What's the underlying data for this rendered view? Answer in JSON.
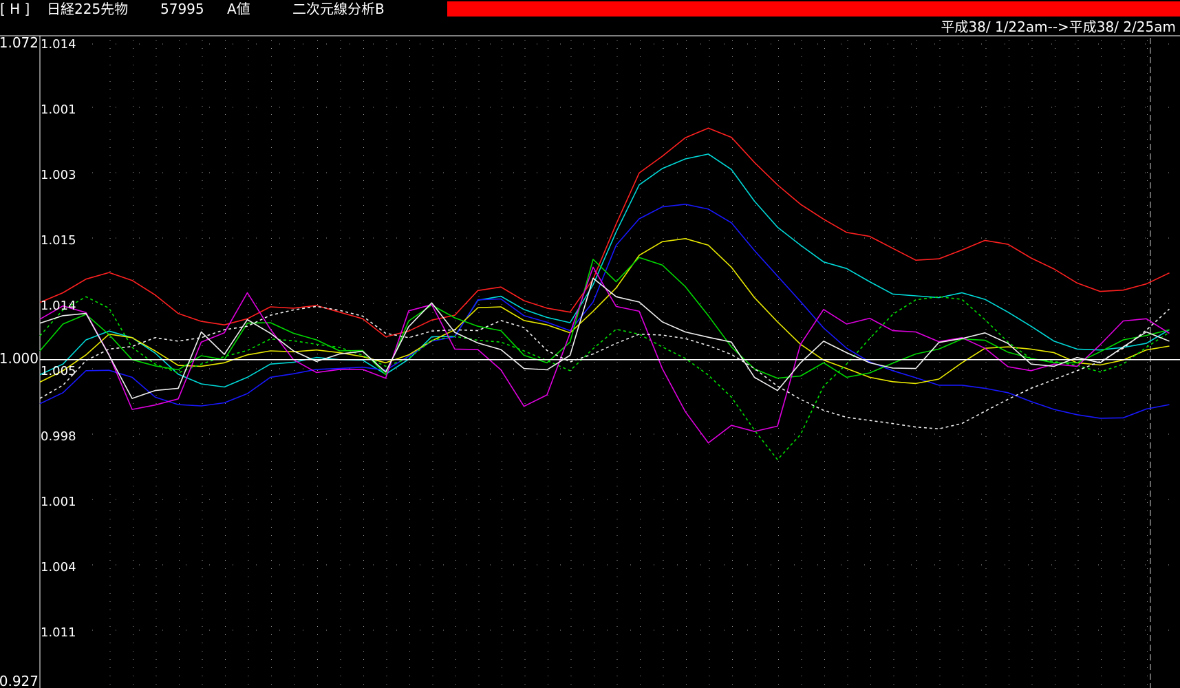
{
  "header": {
    "flag": "[ H ]",
    "instrument": "日経225先物",
    "code": "57995",
    "value_label": "A値",
    "mode": "二次元線分析B"
  },
  "range_label": "平成38/ 1/22am-->平成38/ 2/25am",
  "colors": {
    "background": "#000000",
    "alert_bar": "#ff0000",
    "grid": "#9a9a9a",
    "baseline": "#ffffff"
  },
  "chart_data": {
    "type": "line",
    "grid": true,
    "outer_axis_labels": [
      "1.072",
      "1.000",
      "0.927"
    ],
    "outer_ylim": [
      0.927,
      1.072
    ],
    "inner_axis_labels": [
      "1.014",
      "1.001",
      "1.003",
      "1.015",
      "1.014",
      "1.005",
      "0.998",
      "1.001",
      "1.004",
      "1.011"
    ],
    "baseline": 1.0,
    "n_points": 50,
    "series": [
      {
        "color": "#ff2020",
        "dashed": false,
        "values": [
          1.013,
          1.0152,
          1.0183,
          1.0198,
          1.018,
          1.0147,
          1.0105,
          1.0087,
          1.0079,
          1.0093,
          1.012,
          1.0117,
          1.0123,
          1.0108,
          1.0093,
          1.0052,
          1.0065,
          1.009,
          1.0101,
          1.0157,
          1.0165,
          1.0134,
          1.0117,
          1.0108,
          1.0183,
          1.0308,
          1.0424,
          1.0462,
          1.0504,
          1.0526,
          1.0505,
          1.0448,
          1.0397,
          1.0353,
          1.0319,
          1.0289,
          1.028,
          1.0253,
          1.0226,
          1.0229,
          1.0249,
          1.0271,
          1.0262,
          1.0231,
          1.0206,
          1.0174,
          1.0155,
          1.0158,
          1.0172,
          1.0197
        ]
      },
      {
        "color": "#00d8d8",
        "dashed": false,
        "values": [
          0.9966,
          0.999,
          1.0045,
          1.0065,
          1.005,
          1.0015,
          0.9967,
          0.9945,
          0.9938,
          0.996,
          0.999,
          0.9994,
          1.0005,
          1.0,
          0.9999,
          0.9967,
          1.0001,
          1.0052,
          1.0053,
          1.0135,
          1.0144,
          1.0114,
          1.0096,
          1.0084,
          1.017,
          1.029,
          1.0397,
          1.0434,
          1.0456,
          1.0467,
          1.0432,
          1.036,
          1.0301,
          1.026,
          1.0222,
          1.0207,
          1.0177,
          1.0149,
          1.0145,
          1.0141,
          1.0152,
          1.0137,
          1.0108,
          1.0076,
          1.0042,
          1.0024,
          1.0022,
          1.0028,
          1.0037,
          1.0068
        ]
      },
      {
        "color": "#1818ff",
        "dashed": false,
        "values": [
          0.99,
          0.9925,
          0.9975,
          0.9976,
          0.996,
          0.9915,
          0.9898,
          0.9895,
          0.9902,
          0.9923,
          0.996,
          0.9968,
          0.9978,
          0.998,
          0.9983,
          0.9976,
          1.0008,
          1.0042,
          1.0052,
          1.0136,
          1.0138,
          1.01,
          1.0085,
          1.0066,
          1.0131,
          1.026,
          1.032,
          1.0347,
          1.0353,
          1.0342,
          1.0311,
          1.0248,
          1.019,
          1.0132,
          1.0072,
          1.0026,
          0.9995,
          0.9975,
          0.9959,
          0.9942,
          0.9942,
          0.9935,
          0.9925,
          0.9905,
          0.9887,
          0.9875,
          0.9867,
          0.9868,
          0.9888,
          0.9898
        ]
      },
      {
        "color": "#e8e800",
        "dashed": false,
        "values": [
          0.9949,
          0.9975,
          1.0011,
          1.0058,
          1.005,
          1.002,
          0.9987,
          0.9985,
          0.9993,
          1.0011,
          1.002,
          1.0018,
          1.0022,
          1.0016,
          1.0007,
          0.9993,
          1.0011,
          1.0043,
          1.0068,
          1.0118,
          1.012,
          1.0089,
          1.0079,
          1.0061,
          1.011,
          1.0163,
          1.0237,
          1.0268,
          1.0275,
          1.026,
          1.021,
          1.0141,
          1.0086,
          1.0035,
          0.9999,
          0.998,
          0.996,
          0.995,
          0.9946,
          0.9956,
          0.9993,
          1.0026,
          1.0029,
          1.0024,
          1.0016,
          0.9993,
          0.9988,
          0.9999,
          1.0022,
          1.0031
        ]
      },
      {
        "color": "#00d800",
        "dashed": false,
        "values": [
          1.002,
          1.0081,
          1.0103,
          1.0057,
          1.0,
          0.9986,
          0.9977,
          1.0009,
          1.0,
          1.0083,
          1.0084,
          1.006,
          1.0045,
          1.002,
          1.0021,
          0.9966,
          1.0088,
          1.0124,
          1.0095,
          1.0076,
          1.0066,
          1.001,
          0.9993,
          1.004,
          1.0228,
          1.0177,
          1.0232,
          1.0215,
          1.0166,
          1.01,
          1.0029,
          0.9979,
          0.9958,
          0.9963,
          0.9993,
          0.996,
          0.997,
          0.9992,
          1.0013,
          1.0024,
          1.0047,
          1.0044,
          1.0017,
          1.0003,
          0.9993,
          0.9993,
          1.0018,
          1.0045,
          1.0055,
          1.0068
        ]
      },
      {
        "color": "#00e000",
        "dashed": true,
        "values": [
          1.0054,
          1.0113,
          1.0143,
          1.0117,
          1.0028,
          0.999,
          0.997,
          0.999,
          1.0007,
          1.0021,
          1.0047,
          1.0043,
          1.0035,
          1.0028,
          1.001,
          0.9985,
          1.0003,
          1.0044,
          1.0053,
          1.0044,
          1.004,
          1.002,
          0.9998,
          0.9975,
          1.0025,
          1.0069,
          1.0058,
          1.0029,
          1.0003,
          0.9965,
          0.9915,
          0.984,
          0.9773,
          0.983,
          0.994,
          0.999,
          1.0048,
          1.0103,
          1.0136,
          1.0143,
          1.0137,
          1.0091,
          1.004,
          1.0002,
          0.9996,
          0.9987,
          0.9972,
          0.999,
          1.0028,
          1.0062
        ]
      },
      {
        "color": "#e000e0",
        "dashed": false,
        "values": [
          1.0092,
          1.0122,
          1.0107,
          1.0011,
          0.9887,
          0.9897,
          0.9911,
          1.004,
          1.0061,
          1.0152,
          1.0069,
          1.0,
          0.9971,
          0.9978,
          0.9978,
          0.9958,
          1.0111,
          1.0125,
          1.0024,
          1.0023,
          0.9977,
          0.9894,
          0.992,
          1.006,
          1.021,
          1.0121,
          1.011,
          0.998,
          0.9882,
          0.9811,
          0.9851,
          0.9837,
          0.9849,
          1.0035,
          1.0114,
          1.0081,
          1.0094,
          1.0066,
          1.0063,
          1.0041,
          1.005,
          1.0026,
          0.9984,
          0.9975,
          0.999,
          0.9985,
          1.0034,
          1.0088,
          1.0093,
          1.006
        ]
      },
      {
        "color": "#f0f0f0",
        "dashed": false,
        "values": [
          1.0083,
          1.01,
          1.0105,
          1.001,
          0.9912,
          0.993,
          0.9935,
          1.0063,
          1.0012,
          1.0091,
          1.006,
          1.002,
          0.9996,
          1.0013,
          1.0019,
          0.9972,
          1.0075,
          1.0129,
          1.0062,
          1.0038,
          1.0023,
          0.998,
          0.9977,
          1.001,
          1.0185,
          1.0143,
          1.0131,
          1.0086,
          1.0063,
          1.0051,
          1.004,
          0.996,
          0.993,
          0.9993,
          1.0042,
          1.0016,
          0.9993,
          0.9981,
          0.998,
          1.0039,
          1.0048,
          1.0061,
          1.0037,
          0.999,
          0.9985,
          1.0005,
          0.9993,
          1.0029,
          1.0063,
          1.0042
        ]
      },
      {
        "color": "#f0f0f0",
        "dashed": true,
        "values": [
          0.9912,
          0.9942,
          0.9998,
          1.0024,
          1.003,
          1.005,
          1.0042,
          1.005,
          1.0068,
          1.0076,
          1.0101,
          1.0113,
          1.0121,
          1.0112,
          1.0099,
          1.006,
          1.005,
          1.0065,
          1.0068,
          1.0066,
          1.0089,
          1.0073,
          1.0021,
          0.9995,
          1.0013,
          1.0037,
          1.0058,
          1.0056,
          1.0048,
          1.0032,
          1.0012,
          0.998,
          0.994,
          0.991,
          0.9885,
          0.9869,
          0.9862,
          0.9855,
          0.9847,
          0.9843,
          0.9855,
          0.9883,
          0.991,
          0.9935,
          0.9955,
          0.9975,
          0.9996,
          1.0026,
          1.0067,
          1.0115
        ]
      }
    ]
  }
}
